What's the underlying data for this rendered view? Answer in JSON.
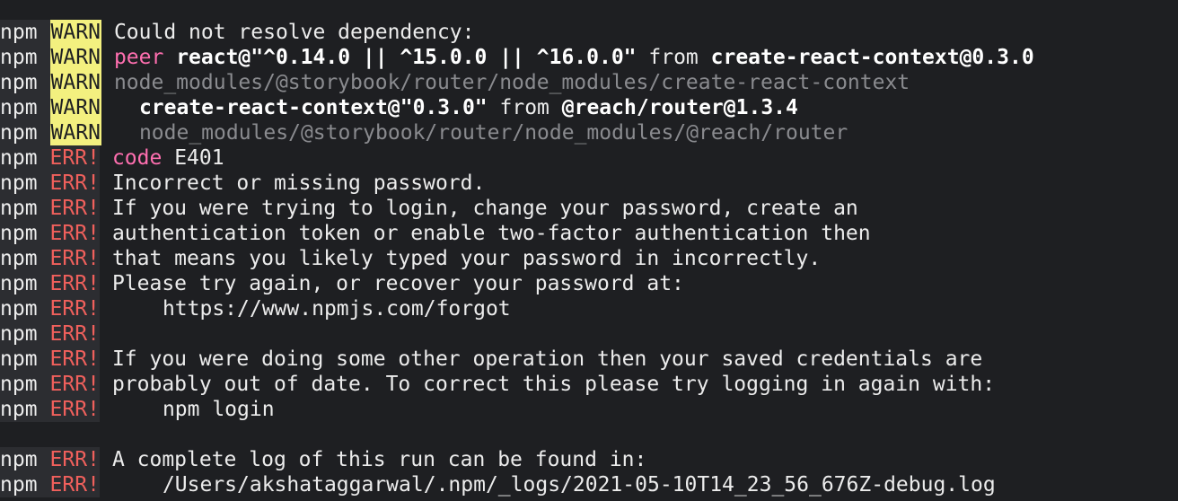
{
  "terminal": {
    "prefix": "npm",
    "warn_tag": "WARN",
    "err_tag": "ERR!",
    "warn_lines": [
      {
        "text": "Could not resolve dependency:"
      },
      {
        "peer_label": "peer",
        "pkg": "react@\"^0.14.0 || ^15.0.0 || ^16.0.0\"",
        "from": " from ",
        "dep": "create-react-context@0.3.0"
      },
      {
        "path": "node_modules/@storybook/router/node_modules/create-react-context"
      },
      {
        "pkg": "create-react-context@\"0.3.0\"",
        "from": " from ",
        "dep": "@reach/router@1.3.4"
      },
      {
        "path": "node_modules/@storybook/router/node_modules/@reach/router"
      }
    ],
    "code_label": "code",
    "code_value": "E401",
    "err_lines": [
      "Incorrect or missing password.",
      "If you were trying to login, change your password, create an",
      "authentication token or enable two-factor authentication then",
      "that means you likely typed your password in incorrectly.",
      "Please try again, or recover your password at:",
      "https://www.npmjs.com/forgot",
      "",
      "If you were doing some other operation then your saved credentials are",
      "probably out of date. To correct this please try logging in again with:",
      "npm login"
    ],
    "log_lines": [
      "A complete log of this run can be found in:",
      "/Users/akshataggarwal/.npm/_logs/2021-05-10T14_23_56_676Z-debug.log"
    ]
  }
}
